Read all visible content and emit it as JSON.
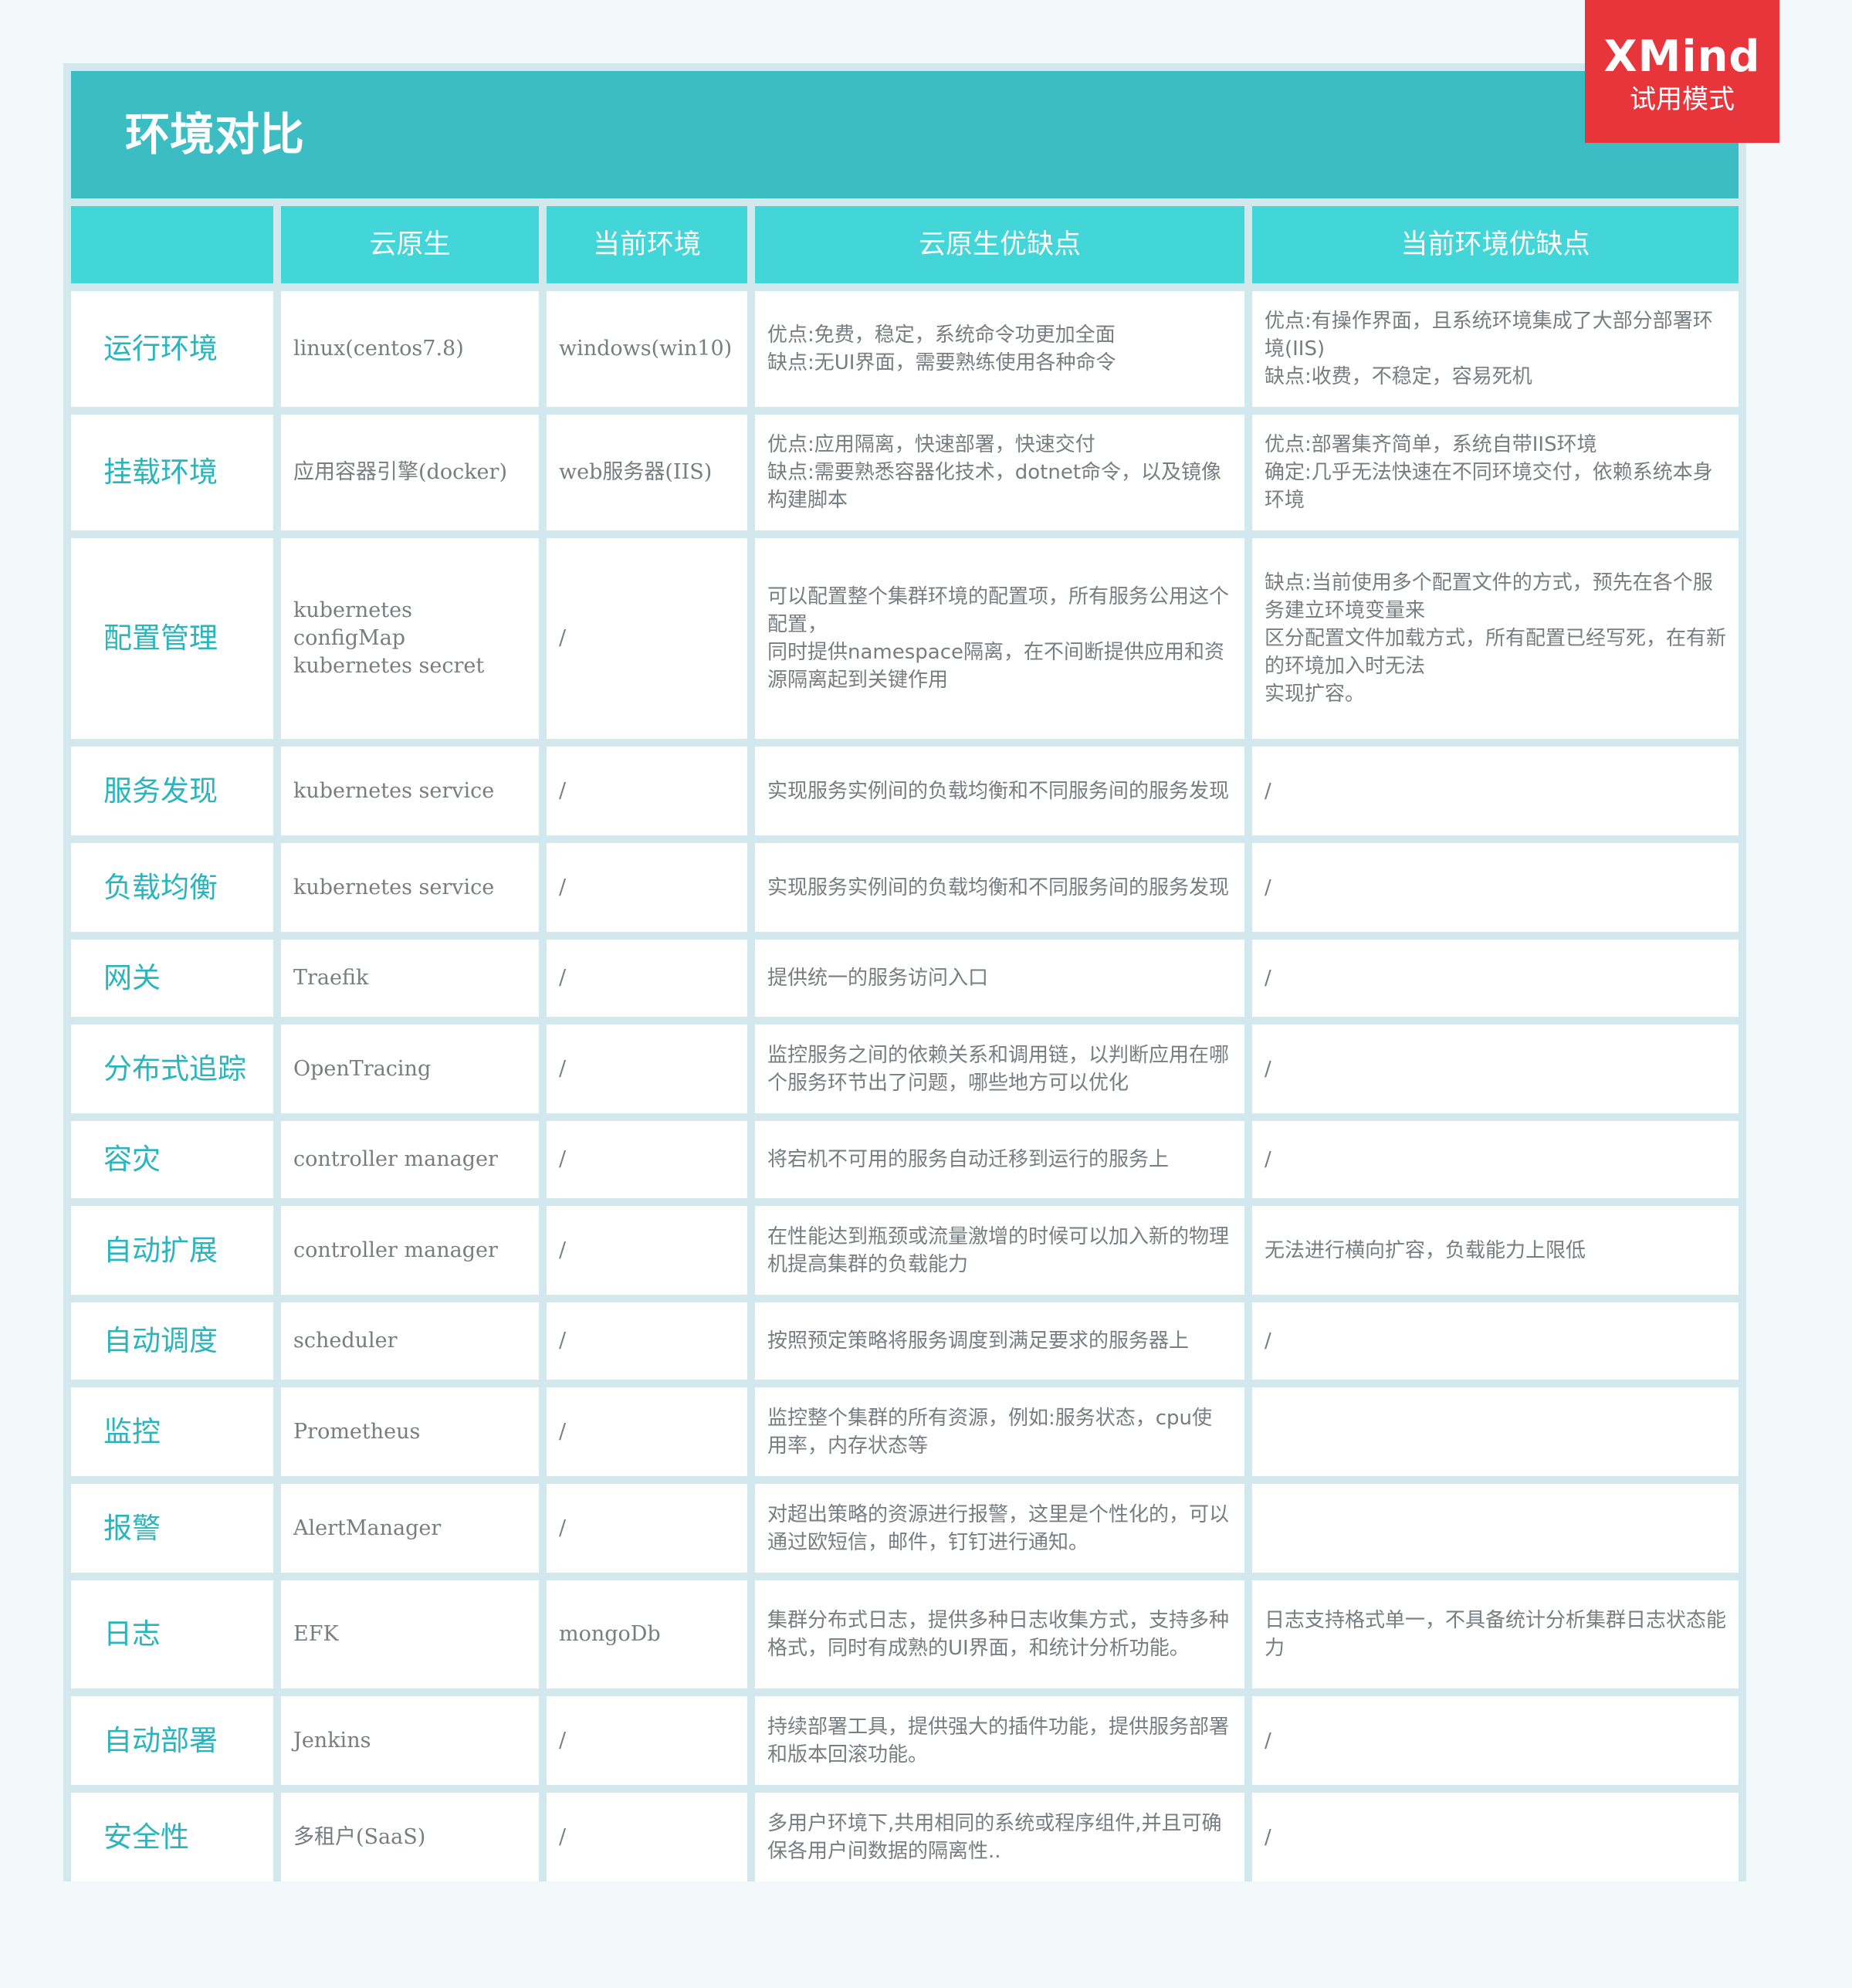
{
  "title": "环境对比",
  "watermark": {
    "logo": "XMind",
    "subtitle": "试用模式"
  },
  "headers": [
    "",
    "云原生",
    "当前环境",
    "云原生优缺点",
    "当前环境优缺点"
  ],
  "rows": [
    [
      "运行环境",
      "linux(centos7.8)",
      "windows(win10)",
      "优点:免费，稳定，系统命令功更加全面\n缺点:无UI界面，需要熟练使用各种命令",
      "优点:有操作界面，且系统环境集成了大部分部署环境(IIS)\n缺点:收费，不稳定，容易死机"
    ],
    [
      "挂载环境",
      "应用容器引擎(docker)",
      "web服务器(IIS)",
      "优点:应用隔离，快速部署，快速交付\n缺点:需要熟悉容器化技术，dotnet命令，以及镜像构建脚本",
      "优点:部署集齐简单，系统自带IIS环境\n确定:几乎无法快速在不同环境交付，依赖系统本身环境"
    ],
    [
      "配置管理",
      "kubernetes configMap\nkubernetes secret",
      "/",
      "可以配置整个集群环境的配置项，所有服务公用这个配置，\n同时提供namespace隔离，在不间断提供应用和资源隔离起到关键作用",
      "缺点:当前使用多个配置文件的方式，预先在各个服务建立环境变量来\n区分配置文件加载方式，所有配置已经写死，在有新的环境加入时无法\n实现扩容。"
    ],
    [
      "服务发现",
      "kubernetes service",
      "/",
      "实现服务实例间的负载均衡和不同服务间的服务发现",
      "/"
    ],
    [
      "负载均衡",
      "kubernetes service",
      "/",
      "实现服务实例间的负载均衡和不同服务间的服务发现",
      "/"
    ],
    [
      "网关",
      "Traefik",
      "/",
      "提供统一的服务访问入口",
      "/"
    ],
    [
      "分布式追踪",
      "OpenTracing",
      "/",
      "监控服务之间的依赖关系和调用链，以判断应用在哪个服务环节出了问题，哪些地方可以优化",
      "/"
    ],
    [
      "容灾",
      "controller manager",
      "/",
      "将宕机不可用的服务自动迁移到运行的服务上",
      "/"
    ],
    [
      "自动扩展",
      "controller manager",
      "/",
      "在性能达到瓶颈或流量激增的时候可以加入新的物理机提高集群的负载能力",
      "无法进行横向扩容，负载能力上限低"
    ],
    [
      "自动调度",
      "scheduler",
      "/",
      "按照预定策略将服务调度到满足要求的服务器上",
      "/"
    ],
    [
      "监控",
      "Prometheus",
      "/",
      "监控整个集群的所有资源，例如:服务状态，cpu使用率，内存状态等",
      ""
    ],
    [
      "报警",
      "AlertManager",
      "/",
      "对超出策略的资源进行报警，这里是个性化的，可以通过欧短信，邮件，钉钉进行通知。",
      ""
    ],
    [
      "日志",
      "EFK",
      "mongoDb",
      "集群分布式日志，提供多种日志收集方式，支持多种格式，同时有成熟的UI界面，和统计分析功能。",
      "日志支持格式单一，不具备统计分析集群日志状态能力"
    ],
    [
      "自动部署",
      "Jenkins",
      "/",
      "持续部署工具，提供强大的插件功能，提供服务部署和版本回滚功能。",
      "/"
    ],
    [
      "安全性",
      "多租户(SaaS)",
      "/",
      "多用户环境下,共用相同的系统或程序组件,并且可确保各用户间数据的隔离性..",
      "/"
    ]
  ]
}
